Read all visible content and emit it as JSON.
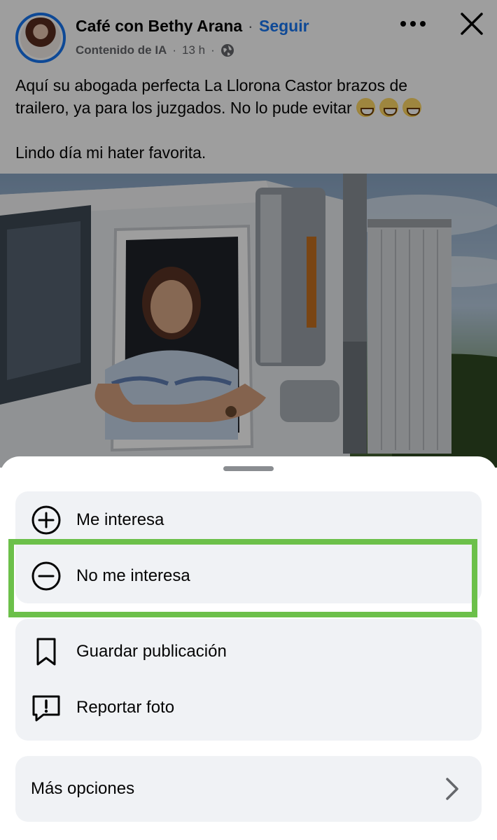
{
  "post": {
    "page_name": "Café con Bethy Arana",
    "separator": "·",
    "follow_label": "Seguir",
    "ai_label": "Contenido de IA",
    "meta_dot": "·",
    "time": "13 h",
    "meta_dot2": "·",
    "text_line1": "Aquí su abogada perfecta La Llorona Castor brazos de",
    "text_line2": "trailero, ya para los juzgados.  No lo pude evitar",
    "text_line3": "Lindo día mi hater favorita."
  },
  "icons": {
    "avatar": "profile-avatar",
    "globe": "globe-icon",
    "more": "more-horizontal-icon",
    "close": "close-icon"
  },
  "menu": {
    "group1": [
      {
        "label": "Me interesa",
        "icon": "plus-circle-icon"
      },
      {
        "label": "No me interesa",
        "icon": "minus-circle-icon"
      }
    ],
    "group2": [
      {
        "label": "Guardar publicación",
        "icon": "bookmark-icon"
      },
      {
        "label": "Reportar foto",
        "icon": "report-icon"
      }
    ],
    "group3": [
      {
        "label": "Más opciones",
        "icon": "chevron-right-icon"
      }
    ]
  },
  "colors": {
    "accent": "#1877f2",
    "highlight": "#6cc04a",
    "sheet_row_bg": "#f0f2f5"
  }
}
